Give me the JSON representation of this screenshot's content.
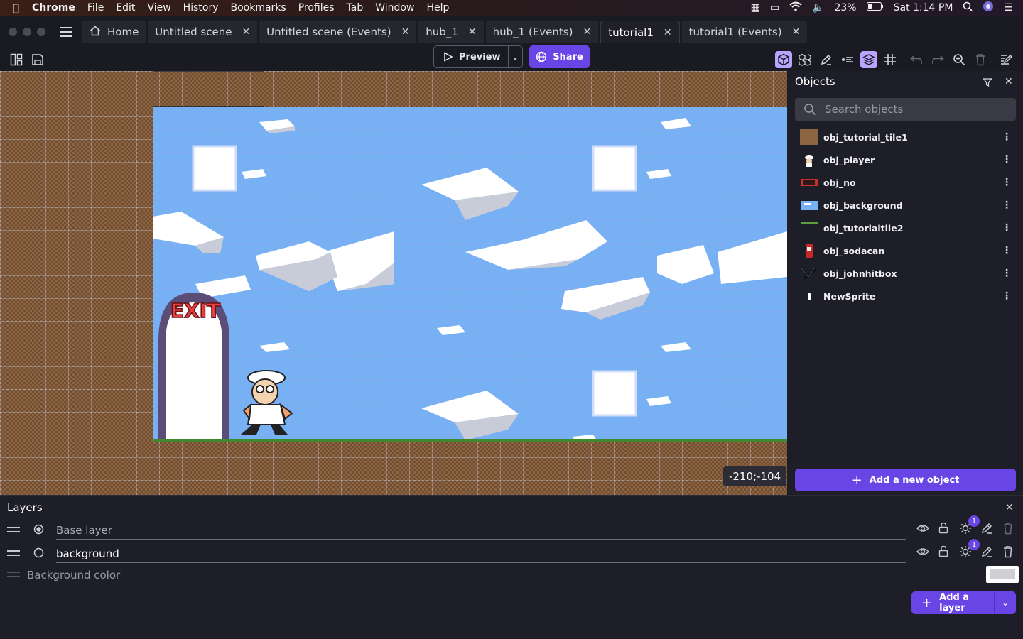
{
  "menubar": {
    "apple": "",
    "app": "Chrome",
    "items": [
      "File",
      "Edit",
      "View",
      "History",
      "Bookmarks",
      "Profiles",
      "Tab",
      "Window",
      "Help"
    ],
    "battery": "23%",
    "clock": "Sat 1:14 PM"
  },
  "tabs": [
    {
      "label": "Home",
      "icon": "home-icon",
      "closable": false
    },
    {
      "label": "Untitled scene",
      "closable": true
    },
    {
      "label": "Untitled scene (Events)",
      "closable": true
    },
    {
      "label": "hub_1",
      "closable": true
    },
    {
      "label": "hub_1 (Events)",
      "closable": true
    },
    {
      "label": "tutorial1",
      "closable": true,
      "active": true
    },
    {
      "label": "tutorial1 (Events)",
      "closable": true
    }
  ],
  "toolbar": {
    "preview_label": "Preview",
    "share_label": "Share"
  },
  "scene": {
    "coordinates": "-210;-104",
    "exit_sign": "EXIT"
  },
  "objects_panel": {
    "title": "Objects",
    "search_placeholder": "Search objects",
    "items": [
      {
        "name": "obj_tutorial_tile1",
        "thumb": "dirt"
      },
      {
        "name": "obj_player",
        "thumb": "chef"
      },
      {
        "name": "obj_no",
        "thumb": "red"
      },
      {
        "name": "obj_background",
        "thumb": "sky"
      },
      {
        "name": "obj_tutorialtile2",
        "thumb": "grass"
      },
      {
        "name": "obj_sodacan",
        "thumb": "can"
      },
      {
        "name": "obj_johnhitbox",
        "thumb": "dark"
      },
      {
        "name": "NewSprite",
        "thumb": "white"
      }
    ],
    "add_label": "Add a new object"
  },
  "layers_panel": {
    "title": "Layers",
    "layers": [
      {
        "name": "Base layer",
        "selected": true,
        "effects_count": "1"
      },
      {
        "name": "background",
        "selected": false,
        "effects_count": "1"
      }
    ],
    "background_color_label": "Background color",
    "add_label": "Add a layer"
  },
  "colors": {
    "accent": "#6a45e6",
    "sky": "#78b0f4",
    "dirt": "#8d6442"
  }
}
